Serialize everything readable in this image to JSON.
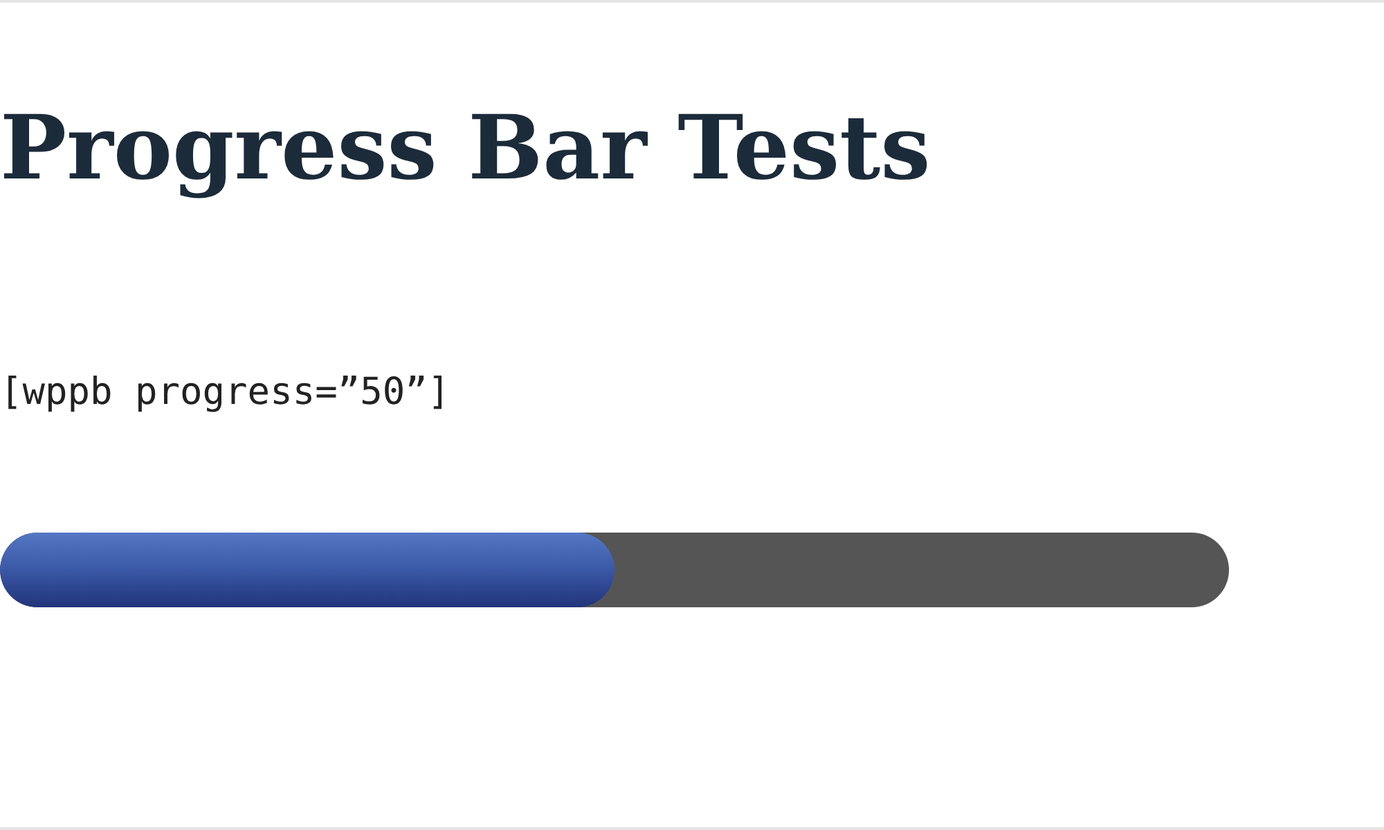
{
  "title": "Progress Bar Tests",
  "shortcode": "[wppb progress=”50”]",
  "progress_bar": {
    "level": 0.5
  }
}
